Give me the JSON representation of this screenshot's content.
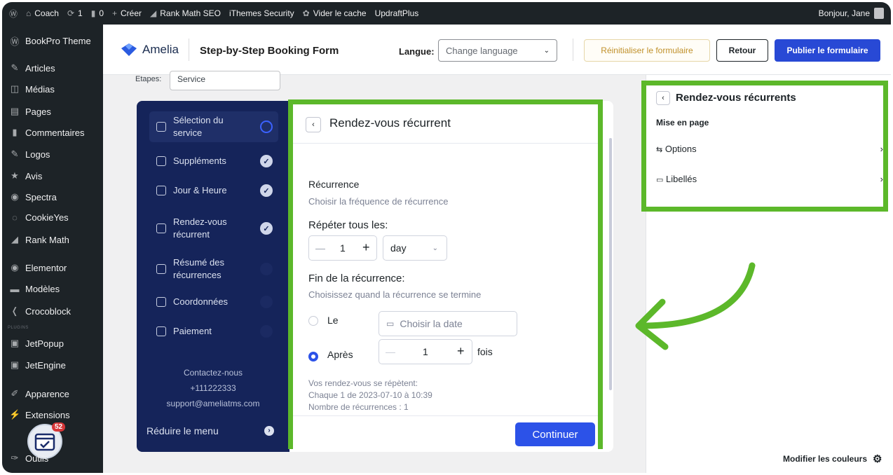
{
  "adminbar": {
    "site_name": "Coach",
    "updates": "1",
    "comments": "0",
    "create": "Créer",
    "rank_math": "Rank Math SEO",
    "ithemes": "iThemes Security",
    "cache": "Vider le cache",
    "updraft": "UpdraftPlus",
    "greeting": "Bonjour, Jane"
  },
  "sidebar": {
    "items": [
      {
        "label": "BookPro Theme",
        "icon": "wordpress-icon"
      },
      {
        "label": "Articles",
        "icon": "pin-icon"
      },
      {
        "label": "Médias",
        "icon": "media-icon"
      },
      {
        "label": "Pages",
        "icon": "page-icon"
      },
      {
        "label": "Commentaires",
        "icon": "comment-icon"
      },
      {
        "label": "Logos",
        "icon": "pin-icon"
      },
      {
        "label": "Avis",
        "icon": "star-icon"
      },
      {
        "label": "Spectra",
        "icon": "spectra-icon"
      },
      {
        "label": "CookieYes",
        "icon": "cookie-icon"
      },
      {
        "label": "Rank Math",
        "icon": "chart-icon"
      },
      {
        "label": "Elementor",
        "icon": "elementor-icon"
      },
      {
        "label": "Modèles",
        "icon": "folder-icon"
      },
      {
        "label": "Crocoblock",
        "icon": "crocoblock-icon"
      },
      {
        "label": "JetPopup",
        "icon": "jet-icon"
      },
      {
        "label": "JetEngine",
        "icon": "jet-icon"
      },
      {
        "label": "Apparence",
        "icon": "brush-icon"
      },
      {
        "label": "Extensions",
        "icon": "plug-icon"
      },
      {
        "label": "Outils",
        "icon": "wrench-icon"
      }
    ],
    "separator": "PLUGINS",
    "fab_badge": "52"
  },
  "header": {
    "logo": "Amelia",
    "title": "Step-by-Step Booking Form",
    "lang_label": "Langue:",
    "lang_placeholder": "Change language",
    "reset": "Réinitialiser le formulaire",
    "back": "Retour",
    "publish": "Publier le formulaire"
  },
  "steps_select": {
    "label": "Etapes:",
    "value": "Service"
  },
  "nav": {
    "items": [
      {
        "label": "Sélection du",
        "label2": "service",
        "state": "current"
      },
      {
        "label": "Suppléments",
        "state": "done"
      },
      {
        "label": "Jour & Heure",
        "state": "done"
      },
      {
        "label": "Rendez-vous",
        "label2": "récurrent",
        "state": "done"
      },
      {
        "label": "Résumé des",
        "label2": "récurrences",
        "state": "todo"
      },
      {
        "label": "Coordonnées",
        "state": "todo"
      },
      {
        "label": "Paiement",
        "state": "todo"
      }
    ],
    "contact_title": "Contactez-nous",
    "contact_phone": "+111222333",
    "contact_email": "support@ameliatms.com",
    "reduce": "Réduire le menu"
  },
  "main_panel": {
    "title": "Rendez-vous récurrent",
    "recurrence_title": "Récurrence",
    "recurrence_sub": "Choisir la fréquence de récurrence",
    "repeat_label": "Répéter tous les:",
    "repeat_value": "1",
    "repeat_unit": "day",
    "end_title": "Fin de la récurrence:",
    "end_sub": "Choisissez quand la récurrence se termine",
    "option_on": "Le",
    "date_placeholder": "Choisir la date",
    "option_after": "Après",
    "after_value": "1",
    "times": "fois",
    "summary1": "Vos rendez-vous se répètent:",
    "summary2": "Chaque 1 de 2023-07-10 à 10:39",
    "summary3": "Nombre de récurrences : 1",
    "continue": "Continuer"
  },
  "right_panel": {
    "title": "Rendez-vous récurrents",
    "section": "Mise en page",
    "options": "Options",
    "labels": "Libellés",
    "modify_colors": "Modifier les couleurs"
  },
  "colors": {
    "accent_green": "#5cb82a",
    "nav_bg": "#15245a",
    "primary": "#2c52e8"
  }
}
